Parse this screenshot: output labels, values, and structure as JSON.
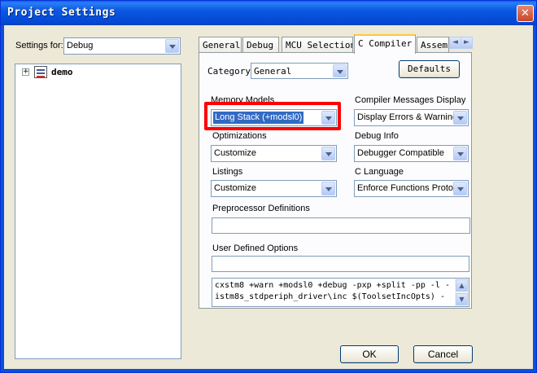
{
  "window": {
    "title": "Project Settings",
    "close_glyph": "✕"
  },
  "settings_for": {
    "label": "Settings for:",
    "value": "Debug"
  },
  "tree": {
    "expander": "+",
    "root_label": "demo",
    "root_icon": "project-icon"
  },
  "tabs": [
    {
      "label": "General"
    },
    {
      "label": "Debug"
    },
    {
      "label": "MCU Selection"
    },
    {
      "label": "C Compiler"
    },
    {
      "label": "Assembler"
    }
  ],
  "tab_scroll": {
    "left": "◄",
    "right": "►"
  },
  "category": {
    "label": "Category",
    "value": "General"
  },
  "defaults_button": "Defaults",
  "memory_models": {
    "label": "Memory Models",
    "value": "Long Stack (+modsl0)"
  },
  "compiler_messages": {
    "label": "Compiler Messages Display",
    "value": "Display Errors & Warning"
  },
  "optimizations": {
    "label": "Optimizations",
    "value": "Customize"
  },
  "debug_info": {
    "label": "Debug Info",
    "value": "Debugger Compatible"
  },
  "listings": {
    "label": "Listings",
    "value": "Customize"
  },
  "c_language": {
    "label": "C Language",
    "value": "Enforce Functions Protot"
  },
  "preprocessor": {
    "label": "Preprocessor Definitions",
    "value": ""
  },
  "user_defined": {
    "label": "User Defined Options",
    "value": ""
  },
  "command_line": {
    "line1": "cxstm8 +warn +modsl0 +debug -pxp +split -pp -l -",
    "line2": "istm8s_stdperiph_driver\\inc $(ToolsetIncOpts) -"
  },
  "buttons": {
    "ok": "OK",
    "cancel": "Cancel"
  },
  "colors": {
    "highlight": "#ff0000",
    "titlebar": "#0a58e0",
    "selection": "#316ac5"
  }
}
